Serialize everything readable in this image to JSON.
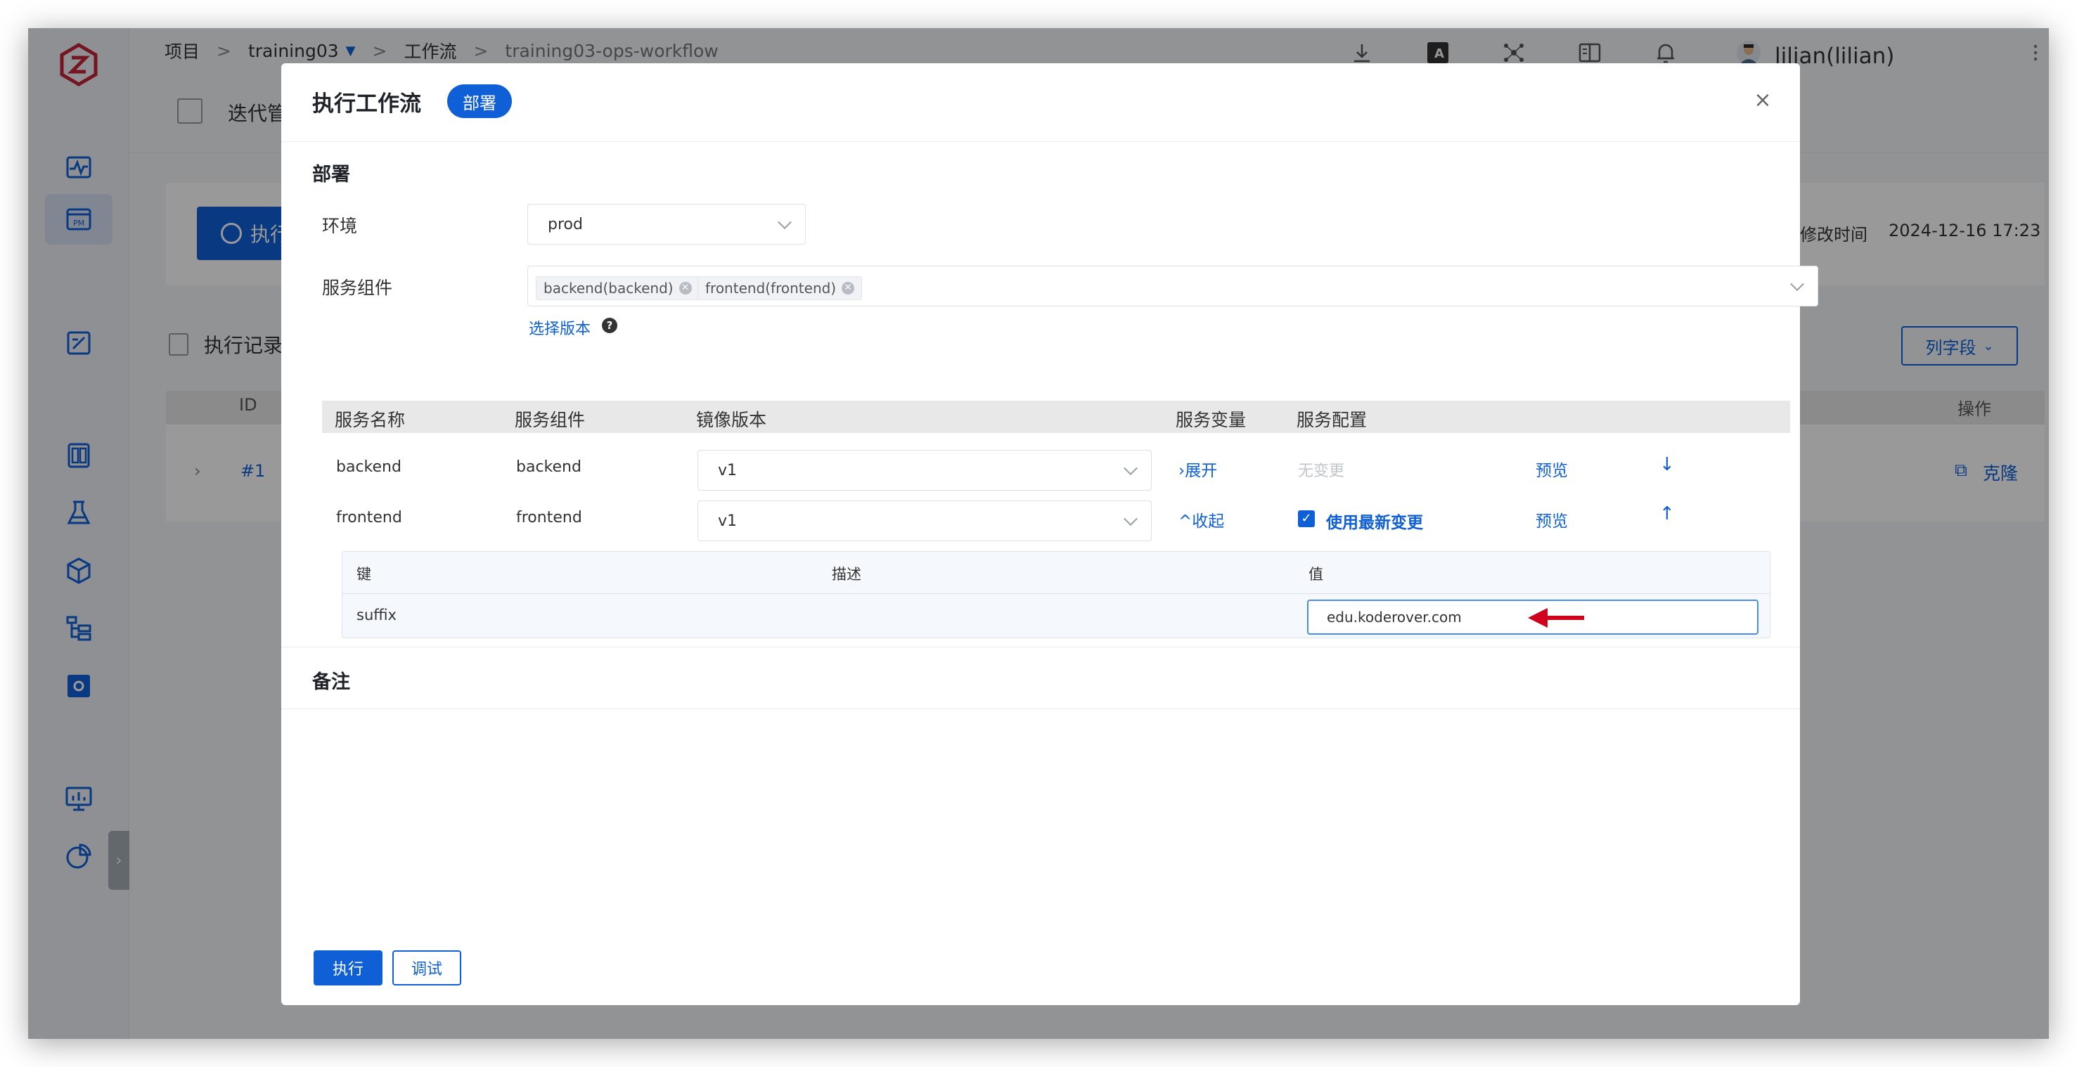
{
  "breadcrumb": {
    "project_label": "项目",
    "project_name": "training03",
    "workflow_label": "工作流",
    "workflow_name": "training03-ops-workflow",
    "separator": ">"
  },
  "topbar": {
    "user_name": "lilian(lilian)",
    "icons": [
      "download-icon",
      "translate-icon",
      "network-icon",
      "docs-icon",
      "bell-icon",
      "avatar",
      "more-icon"
    ]
  },
  "sidebar": {
    "icons": [
      "zadig-logo",
      "dashboard-icon",
      "project-icon",
      "edit-icon",
      "list-icon",
      "flask-icon",
      "package-icon",
      "hierarchy-icon",
      "settings-box-icon",
      "monitor-icon",
      "pie-chart-icon"
    ],
    "toggle": "›"
  },
  "background": {
    "tab_title": "迭代管",
    "run_button": "执行",
    "modified_label": "修改时间",
    "modified_time": "2024-12-16 17:23",
    "records_title": "执行记录",
    "columns_button": "列字段",
    "col_id": "ID",
    "col_action": "操作",
    "row_id": "#1",
    "clone_button": "克隆"
  },
  "modal": {
    "title": "执行工作流",
    "badge": "部署",
    "close": "×",
    "deploy_section_title": "部署",
    "env_label": "环境",
    "env_value": "prod",
    "components_label": "服务组件",
    "components": [
      "backend(backend)",
      "frontend(frontend)"
    ],
    "select_version_link": "选择版本",
    "help": "?",
    "table": {
      "headers": [
        "服务名称",
        "服务组件",
        "镜像版本",
        "服务变量",
        "服务配置"
      ],
      "rows": [
        {
          "service": "backend",
          "component": "backend",
          "image_version": "v1",
          "variables_toggle": "展开",
          "config": "无变更",
          "preview": "预览"
        },
        {
          "service": "frontend",
          "component": "frontend",
          "image_version": "v1",
          "variables_toggle": "收起",
          "config": "使用最新变更",
          "preview": "预览"
        }
      ]
    },
    "variables": {
      "headers": [
        "键",
        "描述",
        "值"
      ],
      "rows": [
        {
          "key": "suffix",
          "description": "",
          "value": "edu.koderover.com"
        }
      ]
    },
    "notes_section_title": "备注",
    "run_button": "执行",
    "debug_button": "调试"
  },
  "colors": {
    "primary": "#0f5fd7",
    "annotation_arrow": "#d0021b",
    "brand_logo": "#c4243a"
  }
}
